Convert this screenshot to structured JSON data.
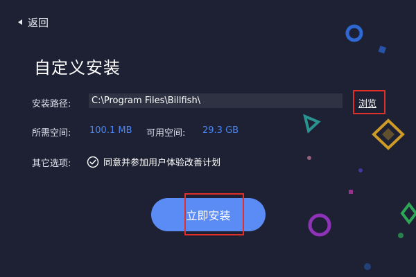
{
  "nav": {
    "back_label": "返回"
  },
  "page": {
    "title": "自定义安装"
  },
  "install_path": {
    "label": "安装路径:",
    "value": "C:\\Program Files\\Billfish\\",
    "browse_label": "浏览"
  },
  "space": {
    "required_label": "所需空间:",
    "required_value": "100.1 MB",
    "available_label": "可用空间:",
    "available_value": "29.3 GB"
  },
  "options": {
    "label": "其它选项:",
    "checkbox_label": "同意并参加用户体验改善计划",
    "checked": true
  },
  "install_button": {
    "label": "立即安装"
  },
  "colors": {
    "background": "#1e2133",
    "accent": "#5b8cf6",
    "value_text": "#4a86f5",
    "highlight_box": "#e0302c"
  }
}
